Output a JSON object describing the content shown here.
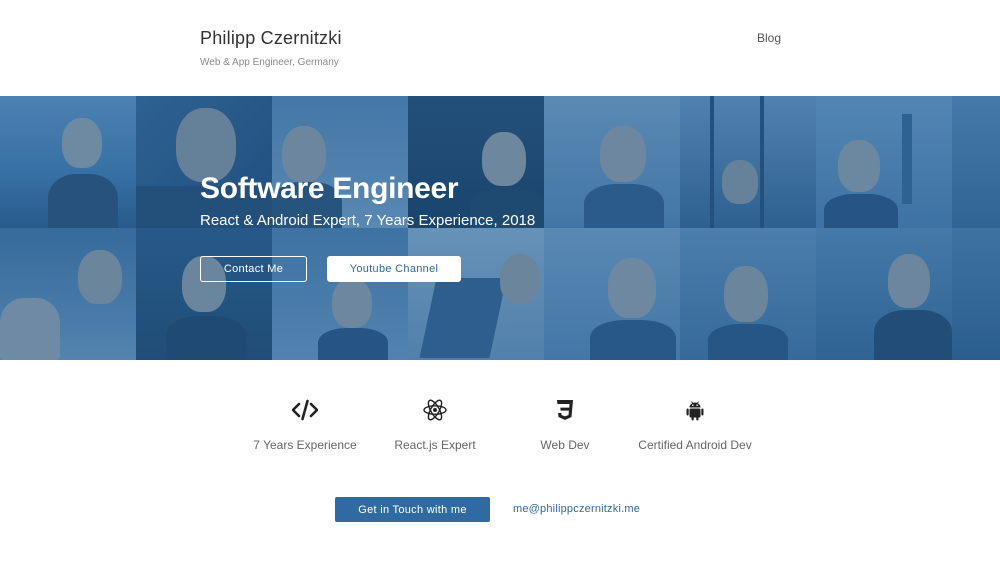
{
  "header": {
    "title": "Philipp Czernitzki",
    "subtitle": "Web & App Engineer, Germany",
    "nav": [
      {
        "label": "Blog"
      }
    ]
  },
  "hero": {
    "title": "Software Engineer",
    "subtitle": "React & Android Expert, 7 Years Experience, 2018",
    "buttons": [
      {
        "label": "Contact Me"
      },
      {
        "label": "Youtube Channel"
      }
    ],
    "overlay_color": "#2f6aa0"
  },
  "features": [
    {
      "icon": "code-icon",
      "label": "7 Years Experience"
    },
    {
      "icon": "react-icon",
      "label": "React.js Expert"
    },
    {
      "icon": "css3-icon",
      "label": "Web Dev"
    },
    {
      "icon": "android-icon",
      "label": "Certified Android Dev"
    }
  ],
  "cta": {
    "button_label": "Get in Touch with me",
    "email": "me@philippczernitzki.me"
  },
  "colors": {
    "accent": "#2f6aa0",
    "text": "#333333",
    "muted": "#8a8a8a"
  }
}
